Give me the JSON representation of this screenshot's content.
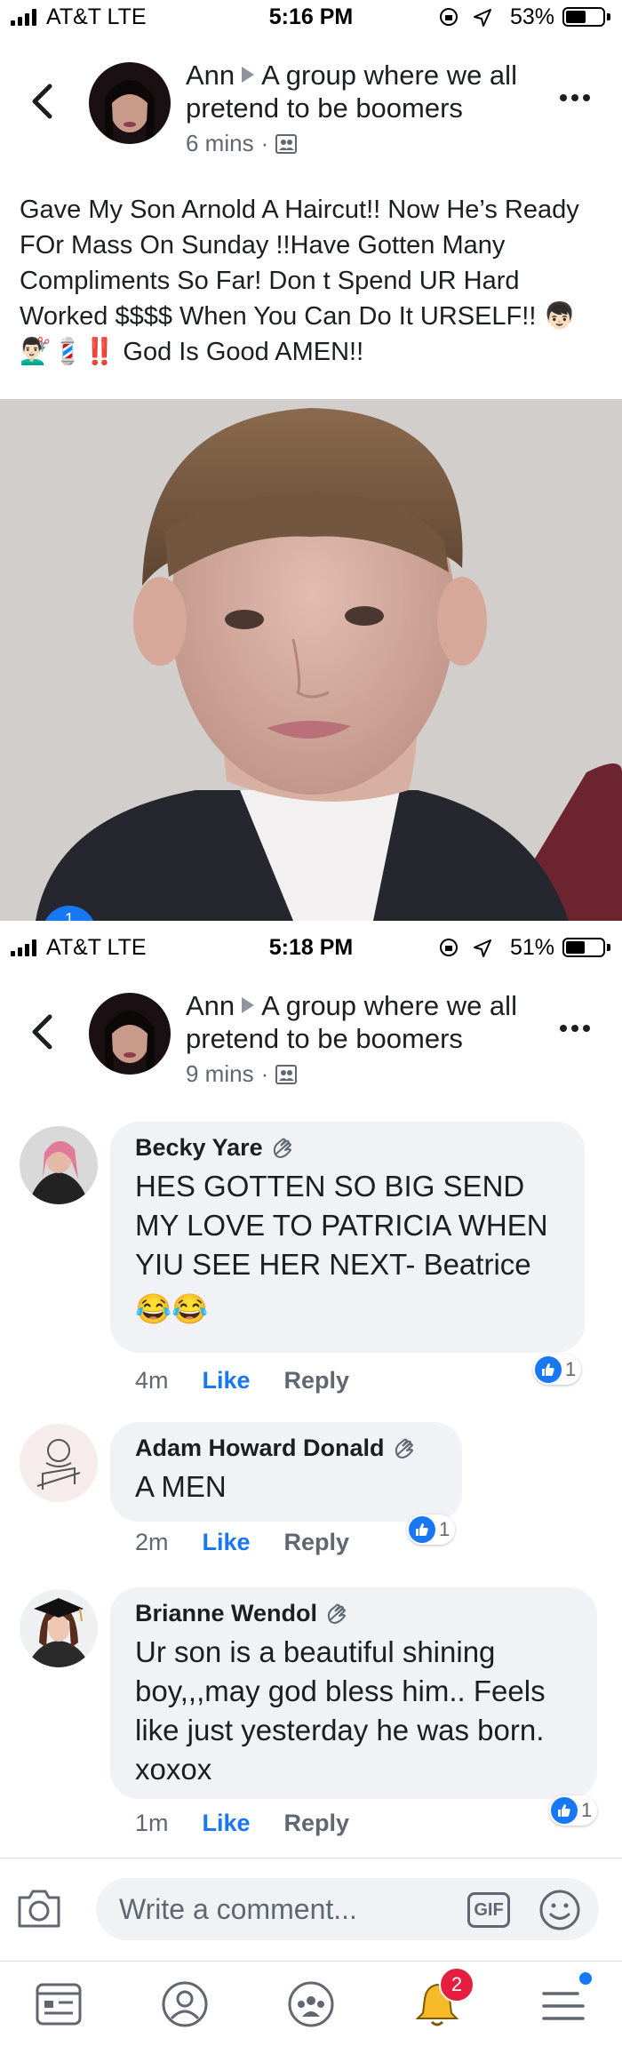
{
  "status1": {
    "carrier": "AT&T  LTE",
    "time": "5:16 PM",
    "battery": "53%",
    "battery_level": 0.53
  },
  "header1": {
    "author": "Ann",
    "group": "A group where we all pretend to be boomers",
    "time": "6 mins"
  },
  "post": {
    "text": "Gave My Son Arnold A Haircut!! Now He’s Ready FOr Mass On Sunday !!Have Gotten Many Compliments So Far! Don t Spend UR Hard Worked $$$$ When You Can Do It URSELF!! 👦🏻💇🏻‍♂️💈‼️ God Is Good AMEN!!"
  },
  "photo_badge": "1",
  "status2": {
    "carrier": "AT&T  LTE",
    "time": "5:18 PM",
    "battery": "51%",
    "battery_level": 0.51
  },
  "header2": {
    "author": "Ann",
    "group": "A group where we all pretend to be boomers",
    "time": "9 mins"
  },
  "comments": [
    {
      "name": "Becky Yare",
      "text": "HES GOTTEN SO BIG SEND MY LOVE TO PATRICIA WHEN YIU SEE HER NEXT- Beatrice",
      "emoji": "😂😂",
      "time": "4m",
      "like": "Like",
      "reply": "Reply",
      "reactions": "1"
    },
    {
      "name": "Adam Howard Donald",
      "text": "A MEN",
      "time": "2m",
      "like": "Like",
      "reply": "Reply",
      "reactions": "1"
    },
    {
      "name": "Brianne Wendol",
      "text": "Ur son is a beautiful shining boy,,,may god bless him.. Feels like just yesterday he was born. xoxox",
      "time": "1m",
      "like": "Like",
      "reply": "Reply",
      "reactions": "1"
    }
  ],
  "composer": {
    "placeholder": "Write a comment...",
    "gif": "GIF"
  },
  "tabbar": {
    "notifications_badge": "2"
  },
  "icons": {
    "back": "chevron-left-icon",
    "more": "more-icon",
    "privacy": "group-privacy-icon",
    "wave": "wave-icon",
    "camera": "camera-icon",
    "smile": "emoji-icon",
    "feed": "news-feed-icon",
    "profile": "profile-icon",
    "groups": "groups-icon",
    "bell": "bell-icon",
    "menu": "menu-icon"
  },
  "colors": {
    "accent": "#1877f2",
    "badge": "#e41e3f"
  }
}
